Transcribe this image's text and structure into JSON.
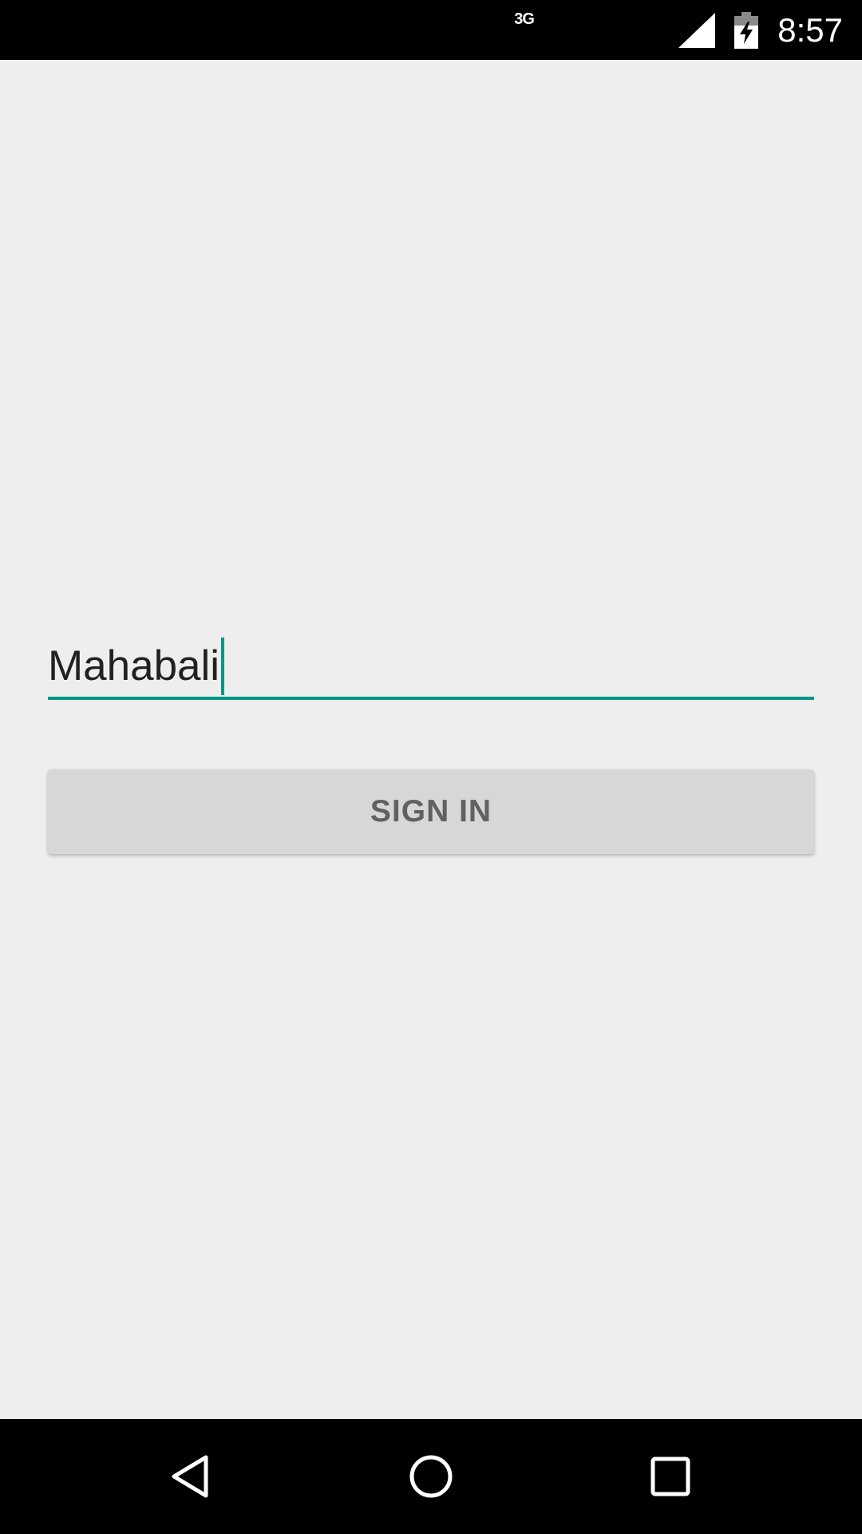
{
  "status_bar": {
    "network_type": "3G",
    "time": "8:57",
    "icons": [
      "signal-icon",
      "battery-charging-icon"
    ]
  },
  "form": {
    "name_value": "Mahabali",
    "accent_color": "#009688",
    "signin_label": "SIGN IN"
  },
  "nav_bar": {
    "icons": [
      "back-icon",
      "home-icon",
      "recents-icon"
    ]
  }
}
